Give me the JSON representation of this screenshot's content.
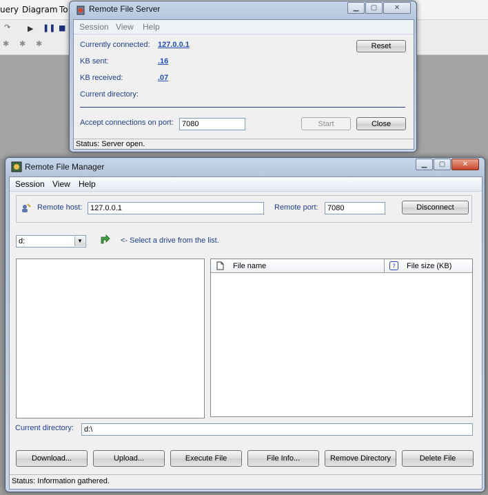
{
  "background_app": {
    "menu": [
      "uery",
      "Diagram",
      "To"
    ]
  },
  "server_window": {
    "title": "Remote File Server",
    "menu": [
      "Session",
      "View",
      "Help"
    ],
    "currently_connected_label": "Currently connected:",
    "currently_connected_value": "127.0.0.1",
    "kb_sent_label": "KB sent:",
    "kb_sent_value": ".16",
    "kb_received_label": "KB received:",
    "kb_received_value": ".07",
    "current_directory_label": "Current directory:",
    "reset_label": "Reset",
    "port_label": "Accept connections on port:",
    "port_value": "7080",
    "start_label": "Start",
    "close_label": "Close",
    "status": "Status: Server open."
  },
  "manager_window": {
    "title": "Remote File Manager",
    "menu": [
      "Session",
      "View",
      "Help"
    ],
    "remote_host_label": "Remote host:",
    "remote_host_value": "127.0.0.1",
    "remote_port_label": "Remote port:",
    "remote_port_value": "7080",
    "disconnect_label": "Disconnect",
    "drive_value": "d:",
    "drive_hint": "<- Select a drive from the list.",
    "file_columns": [
      "File name",
      "File size (KB)"
    ],
    "current_directory_label": "Current directory:",
    "current_directory_value": "d:\\",
    "buttons": [
      "Download...",
      "Upload...",
      "Execute File",
      "File Info...",
      "Remove Directory",
      "Delete File"
    ],
    "status": "Status: Information gathered."
  }
}
